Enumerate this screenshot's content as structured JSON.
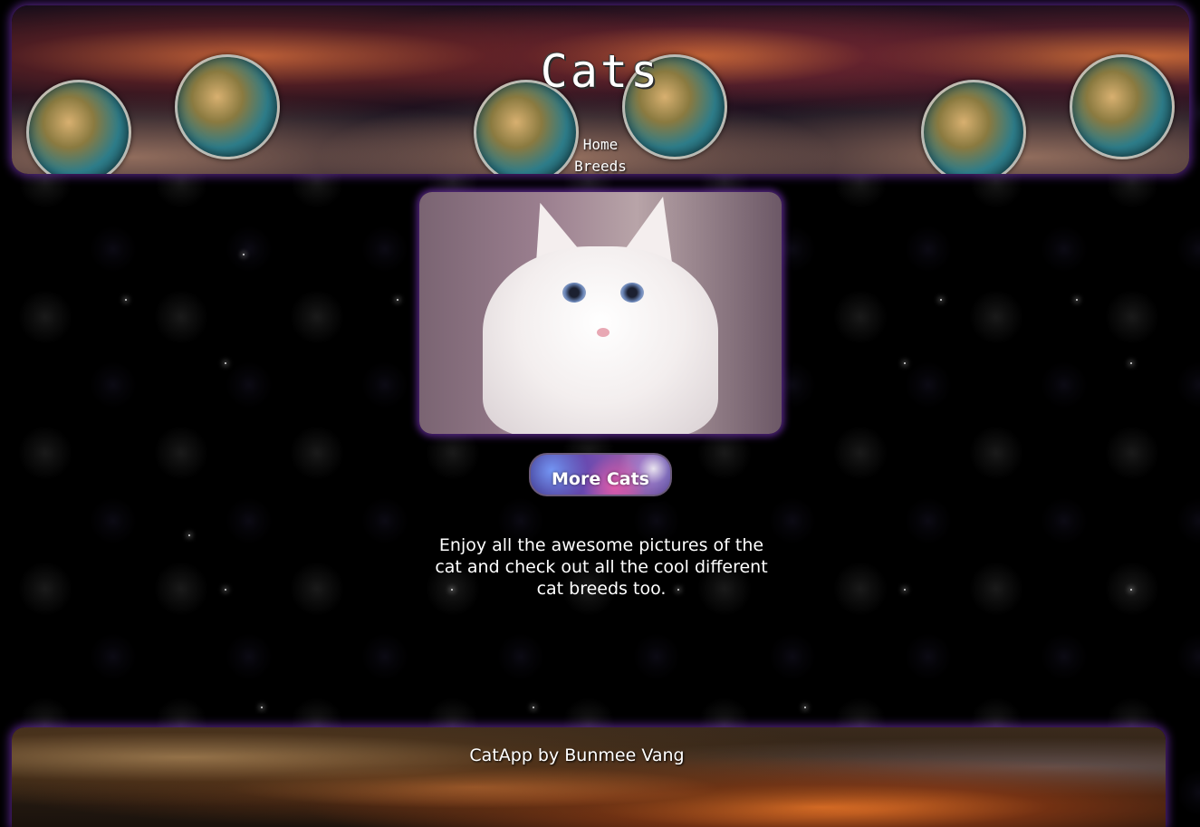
{
  "header": {
    "title": "Cats",
    "nav": [
      {
        "label": "Home"
      },
      {
        "label": "Breeds"
      }
    ]
  },
  "hero": {
    "image_description": "white-kitten-photo"
  },
  "actions": {
    "more_label": "More Cats"
  },
  "main": {
    "blurb": "Enjoy all the awesome pictures of the cat and check out all the cool different cat breeds too."
  },
  "footer": {
    "credit": "CatApp by Bunmee Vang"
  },
  "colors": {
    "background": "#000000",
    "glow": "#8c3cdc",
    "text": "#ffffff"
  }
}
